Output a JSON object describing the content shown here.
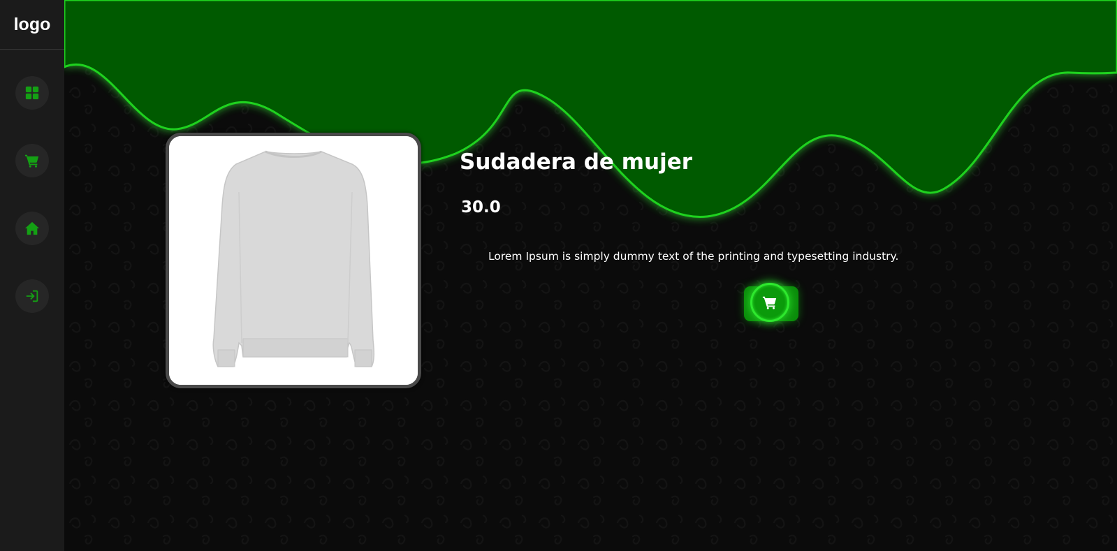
{
  "sidebar": {
    "logo": "logo",
    "items": [
      {
        "icon": "grid-icon",
        "label": "dashboard"
      },
      {
        "icon": "cart-icon",
        "label": "cart"
      },
      {
        "icon": "home-icon",
        "label": "home"
      },
      {
        "icon": "sign-in-icon",
        "label": "login"
      }
    ]
  },
  "product": {
    "title": "Sudadera de mujer",
    "price": "30.0",
    "description": "Lorem Ipsum is simply dummy text of the printing and typesetting industry.",
    "image": "grey-sweatshirt"
  },
  "add_to_cart": {
    "icon": "cart-icon"
  },
  "colors": {
    "sidebar": "#1b1b1b",
    "accent": "#14a014",
    "wave": "#005a00",
    "glow": "#2ee82e",
    "background": "#0b0b0b"
  }
}
